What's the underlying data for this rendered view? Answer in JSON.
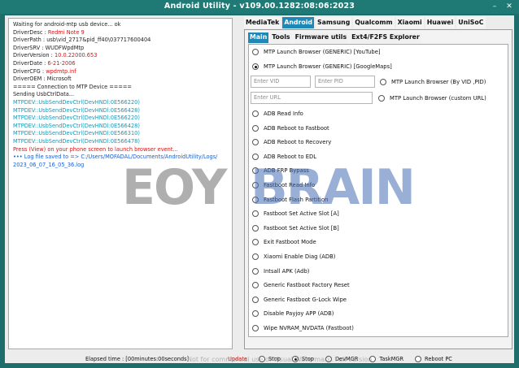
{
  "window": {
    "title": "Android Utility - v109.00.1282:08:06:2023",
    "minimize": "–",
    "close": "✕"
  },
  "log": [
    {
      "parts": [
        {
          "t": "Waiting for android-mtp usb device... ok",
          "c": "dk"
        }
      ]
    },
    {
      "parts": [
        {
          "t": "DriverDesc : ",
          "c": "lbl"
        },
        {
          "t": "Redmi Note 9",
          "c": "red"
        }
      ]
    },
    {
      "parts": [
        {
          "t": "DriverPath : usb\\vid_2717&pid_ff40\\037717600404",
          "c": "lbl"
        }
      ]
    },
    {
      "parts": [
        {
          "t": "DriverSRV : WUDFWpdMtp",
          "c": "lbl"
        }
      ]
    },
    {
      "parts": [
        {
          "t": "DriverVersion : ",
          "c": "lbl"
        },
        {
          "t": "10.0.22000.653",
          "c": "red"
        }
      ]
    },
    {
      "parts": [
        {
          "t": "DriverDate : ",
          "c": "lbl"
        },
        {
          "t": "6-21-2006",
          "c": "red"
        }
      ]
    },
    {
      "parts": [
        {
          "t": "DriverCFG : ",
          "c": "lbl"
        },
        {
          "t": "wpdmtp.inf",
          "c": "red"
        }
      ]
    },
    {
      "parts": [
        {
          "t": "DriverOEM : Microsoft",
          "c": "lbl"
        }
      ]
    },
    {
      "parts": [
        {
          "t": "===== Connection to MTP Device =====",
          "c": "lbl"
        }
      ]
    },
    {
      "parts": [
        {
          "t": "Sending UsbCtrlData...",
          "c": "lbl"
        }
      ]
    },
    {
      "parts": [
        {
          "t": "MTPDEV::UsbSendDevCtrl(DevHNDl:0E566220)",
          "c": "teal"
        }
      ]
    },
    {
      "parts": [
        {
          "t": "MTPDEV::UsbSendDevCtrl(DevHNDl:0E566428)",
          "c": "teal"
        }
      ]
    },
    {
      "parts": [
        {
          "t": "MTPDEV::UsbSendDevCtrl(DevHNDl:0E566220)",
          "c": "teal"
        }
      ]
    },
    {
      "parts": [
        {
          "t": "MTPDEV::UsbSendDevCtrl(DevHNDl:0E566428)",
          "c": "teal"
        }
      ]
    },
    {
      "parts": [
        {
          "t": "MTPDEV::UsbSendDevCtrl(DevHNDl:0E566310)",
          "c": "teal"
        }
      ]
    },
    {
      "parts": [
        {
          "t": "MTPDEV::UsbSendDevCtrl(DevHNDl:0E566478)",
          "c": "teal"
        }
      ]
    },
    {
      "parts": [
        {
          "t": "Press (View) on your phone screen to launch browser event...",
          "c": "red"
        }
      ]
    },
    {
      "parts": [
        {
          "t": "••• Log file saved to => C:/Users/MOFADAL/Documents/AndroidUtility/Logs/",
          "c": "blue"
        }
      ]
    },
    {
      "parts": [
        {
          "t": "2023_06_07_16_05_36.log",
          "c": "blue"
        }
      ]
    }
  ],
  "top_tabs": [
    {
      "label": "MediaTek",
      "active": false
    },
    {
      "label": "Android",
      "active": true
    },
    {
      "label": "Samsung",
      "active": false
    },
    {
      "label": "Qualcomm",
      "active": false
    },
    {
      "label": "Xiaomi",
      "active": false
    },
    {
      "label": "Huawei",
      "active": false
    },
    {
      "label": "UniSoC",
      "active": false
    }
  ],
  "sub_tabs": [
    {
      "label": "Main",
      "active": true
    },
    {
      "label": "Tools",
      "active": false
    },
    {
      "label": "Firmware utils",
      "active": false
    },
    {
      "label": "Ext4/F2FS Explorer",
      "active": false
    }
  ],
  "options_top": [
    {
      "label": "MTP Launch Browser (GENERIC) [YouTube]",
      "selected": false
    },
    {
      "label": "MTP Launch Browser (GENERIC) [GoogleMaps]",
      "selected": true
    }
  ],
  "inputs": {
    "vid_placeholder": "Enter VID",
    "pid_placeholder": "Enter PID",
    "url_placeholder": "Enter URL",
    "vid_pid_option": "MTP Launch Browser (By VID ,PID)",
    "custom_url_option": "MTP Launch Browser (custom URL)"
  },
  "options_list": [
    "ADB Read Info",
    "ADB Reboot to Fastboot",
    "ADB Reboot to Recovery",
    "ADB Reboot to EDL",
    "ADB FRP Bypass",
    "Fastboot Read Info",
    "Fastboot Flash Partition",
    "Fastboot Set Active Slot [A]",
    "Fastboot Set Active Slot [B]",
    "Exit Fastboot Mode",
    "Xiaomi Enable Diag (ADB)",
    "Intsall APK (Adb)",
    "Generic Fastboot Factory Reset",
    "Generic Fastboot G-Lock Wipe",
    "Disable Payjoy APP (ADB)",
    "Wipe NVRAM_NVDATA (Fastboot)"
  ],
  "status": {
    "elapsed": "Elapsed time : [00minutes:00seconds]",
    "update": "Update",
    "radios": [
      {
        "label": "Stop",
        "selected": false
      },
      {
        "label": "Stop",
        "selected": true
      },
      {
        "label": "DevMGR",
        "selected": false
      },
      {
        "label": "TaskMGR",
        "selected": false
      },
      {
        "label": "Reboot PC",
        "selected": false
      }
    ]
  },
  "watermark": {
    "left": "EOY",
    "right": "BRAIN",
    "strip": "Not for commercial use of Visual Watermark. Full version"
  },
  "colors": {
    "titlebar": "#1f7a76",
    "tab_active": "#1e88b8",
    "value_red": "#d11111",
    "log_teal": "#1699b8",
    "log_blue": "#1a5fd0"
  }
}
